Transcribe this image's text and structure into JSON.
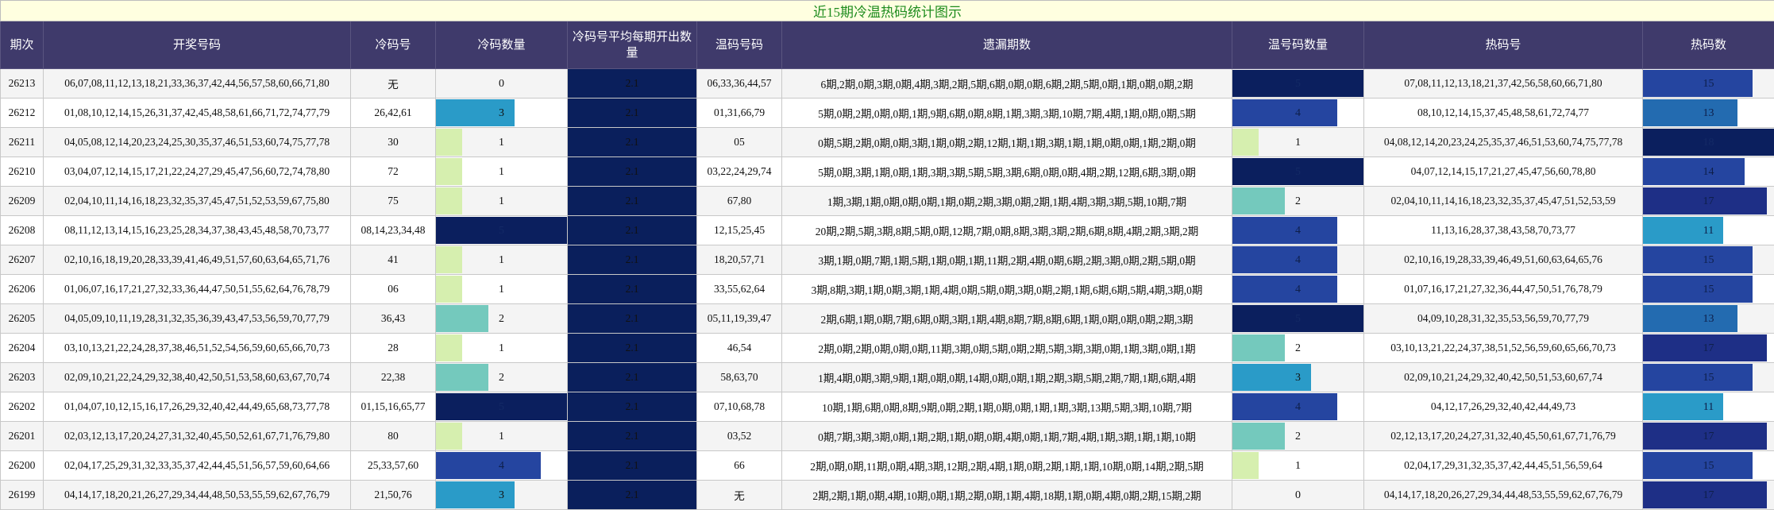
{
  "title": "近15期冷温热码统计图示",
  "headers": [
    "期次",
    "开奖号码",
    "冷码号",
    "冷码数量",
    "冷码号平均每期开出数量",
    "温码号码",
    "遗漏期数",
    "温号码数量",
    "热码号",
    "热码数"
  ],
  "max_cold": 5,
  "max_warm": 5,
  "max_hot": 18,
  "rows": [
    {
      "issue": "26213",
      "numbers": "06,07,08,11,12,13,18,21,33,36,37,42,44,56,57,58,60,66,71,80",
      "cold": "无",
      "cold_count": 0,
      "avg": "2.1",
      "warm": "06,33,36,44,57",
      "miss": "6期,2期,0期,3期,0期,4期,3期,2期,5期,6期,0期,0期,6期,2期,5期,0期,1期,0期,0期,2期",
      "warm_count": 5,
      "hot": "07,08,11,12,13,18,21,37,42,56,58,60,66,71,80",
      "hot_count": 15
    },
    {
      "issue": "26212",
      "numbers": "01,08,10,12,14,15,26,31,37,42,45,48,58,61,66,71,72,74,77,79",
      "cold": "26,42,61",
      "cold_count": 3,
      "avg": "2.1",
      "warm": "01,31,66,79",
      "miss": "5期,0期,2期,0期,0期,1期,9期,6期,0期,8期,1期,3期,3期,10期,7期,4期,1期,0期,0期,5期",
      "warm_count": 4,
      "hot": "08,10,12,14,15,37,45,48,58,61,72,74,77",
      "hot_count": 13
    },
    {
      "issue": "26211",
      "numbers": "04,05,08,12,14,20,23,24,25,30,35,37,46,51,53,60,74,75,77,78",
      "cold": "30",
      "cold_count": 1,
      "avg": "2.1",
      "warm": "05",
      "miss": "0期,5期,2期,0期,0期,3期,1期,0期,2期,12期,1期,1期,3期,1期,1期,0期,0期,1期,2期,0期",
      "warm_count": 1,
      "hot": "04,08,12,14,20,23,24,25,35,37,46,51,53,60,74,75,77,78",
      "hot_count": 18
    },
    {
      "issue": "26210",
      "numbers": "03,04,07,12,14,15,17,21,22,24,27,29,45,47,56,60,72,74,78,80",
      "cold": "72",
      "cold_count": 1,
      "avg": "2.1",
      "warm": "03,22,24,29,74",
      "miss": "5期,0期,3期,1期,0期,1期,3期,3期,5期,5期,3期,6期,0期,0期,4期,2期,12期,6期,3期,0期",
      "warm_count": 5,
      "hot": "04,07,12,14,15,17,21,27,45,47,56,60,78,80",
      "hot_count": 14
    },
    {
      "issue": "26209",
      "numbers": "02,04,10,11,14,16,18,23,32,35,37,45,47,51,52,53,59,67,75,80",
      "cold": "75",
      "cold_count": 1,
      "avg": "2.1",
      "warm": "67,80",
      "miss": "1期,3期,1期,0期,0期,0期,1期,0期,2期,3期,0期,2期,1期,4期,3期,3期,5期,10期,7期",
      "warm_count": 2,
      "hot": "02,04,10,11,14,16,18,23,32,35,37,45,47,51,52,53,59",
      "hot_count": 17
    },
    {
      "issue": "26208",
      "numbers": "08,11,12,13,14,15,16,23,25,28,34,37,38,43,45,48,58,70,73,77",
      "cold": "08,14,23,34,48",
      "cold_count": 5,
      "avg": "2.1",
      "warm": "12,15,25,45",
      "miss": "20期,2期,5期,3期,8期,5期,0期,12期,7期,0期,8期,3期,3期,2期,6期,8期,4期,2期,3期,2期",
      "warm_count": 4,
      "hot": "11,13,16,28,37,38,43,58,70,73,77",
      "hot_count": 11
    },
    {
      "issue": "26207",
      "numbers": "02,10,16,18,19,20,28,33,39,41,46,49,51,57,60,63,64,65,71,76",
      "cold": "41",
      "cold_count": 1,
      "avg": "2.1",
      "warm": "18,20,57,71",
      "miss": "3期,1期,0期,7期,1期,5期,1期,0期,1期,11期,2期,4期,0期,6期,2期,3期,0期,2期,5期,0期",
      "warm_count": 4,
      "hot": "02,10,16,19,28,33,39,46,49,51,60,63,64,65,76",
      "hot_count": 15
    },
    {
      "issue": "26206",
      "numbers": "01,06,07,16,17,21,27,32,33,36,44,47,50,51,55,62,64,76,78,79",
      "cold": "06",
      "cold_count": 1,
      "avg": "2.1",
      "warm": "33,55,62,64",
      "miss": "3期,8期,3期,1期,0期,3期,1期,4期,0期,5期,0期,3期,0期,2期,1期,6期,6期,5期,4期,3期,0期",
      "warm_count": 4,
      "hot": "01,07,16,17,21,27,32,36,44,47,50,51,76,78,79",
      "hot_count": 15
    },
    {
      "issue": "26205",
      "numbers": "04,05,09,10,11,19,28,31,32,35,36,39,43,47,53,56,59,70,77,79",
      "cold": "36,43",
      "cold_count": 2,
      "avg": "2.1",
      "warm": "05,11,19,39,47",
      "miss": "2期,6期,1期,0期,7期,6期,0期,3期,1期,4期,8期,7期,8期,6期,1期,0期,0期,0期,2期,3期",
      "warm_count": 5,
      "hot": "04,09,10,28,31,32,35,53,56,59,70,77,79",
      "hot_count": 13
    },
    {
      "issue": "26204",
      "numbers": "03,10,13,21,22,24,28,37,38,46,51,52,54,56,59,60,65,66,70,73",
      "cold": "28",
      "cold_count": 1,
      "avg": "2.1",
      "warm": "46,54",
      "miss": "2期,0期,2期,0期,0期,0期,11期,3期,0期,5期,0期,2期,5期,3期,3期,0期,1期,3期,0期,1期",
      "warm_count": 2,
      "hot": "03,10,13,21,22,24,37,38,51,52,56,59,60,65,66,70,73",
      "hot_count": 17
    },
    {
      "issue": "26203",
      "numbers": "02,09,10,21,22,24,29,32,38,40,42,50,51,53,58,60,63,67,70,74",
      "cold": "22,38",
      "cold_count": 2,
      "avg": "2.1",
      "warm": "58,63,70",
      "miss": "1期,4期,0期,3期,9期,1期,0期,0期,14期,0期,0期,1期,2期,3期,5期,2期,7期,1期,6期,4期",
      "warm_count": 3,
      "hot": "02,09,10,21,24,29,32,40,42,50,51,53,60,67,74",
      "hot_count": 15
    },
    {
      "issue": "26202",
      "numbers": "01,04,07,10,12,15,16,17,26,29,32,40,42,44,49,65,68,73,77,78",
      "cold": "01,15,16,65,77",
      "cold_count": 5,
      "avg": "2.1",
      "warm": "07,10,68,78",
      "miss": "10期,1期,6期,0期,8期,9期,0期,2期,1期,0期,0期,1期,1期,3期,13期,5期,3期,10期,7期",
      "warm_count": 4,
      "hot": "04,12,17,26,29,32,40,42,44,49,73",
      "hot_count": 11
    },
    {
      "issue": "26201",
      "numbers": "02,03,12,13,17,20,24,27,31,32,40,45,50,52,61,67,71,76,79,80",
      "cold": "80",
      "cold_count": 1,
      "avg": "2.1",
      "warm": "03,52",
      "miss": "0期,7期,3期,3期,0期,1期,2期,1期,0期,0期,4期,0期,1期,7期,4期,1期,3期,1期,1期,10期",
      "warm_count": 2,
      "hot": "02,12,13,17,20,24,27,31,32,40,45,50,61,67,71,76,79",
      "hot_count": 17
    },
    {
      "issue": "26200",
      "numbers": "02,04,17,25,29,31,32,33,35,37,42,44,45,51,56,57,59,60,64,66",
      "cold": "25,33,57,60",
      "cold_count": 4,
      "avg": "2.1",
      "warm": "66",
      "miss": "2期,0期,0期,11期,0期,4期,3期,12期,2期,4期,1期,0期,2期,1期,1期,10期,0期,14期,2期,5期",
      "warm_count": 1,
      "hot": "02,04,17,29,31,32,35,37,42,44,45,51,56,59,64",
      "hot_count": 15
    },
    {
      "issue": "26199",
      "numbers": "04,14,17,18,20,21,26,27,29,34,44,48,50,53,55,59,62,67,76,79",
      "cold": "21,50,76",
      "cold_count": 3,
      "avg": "2.1",
      "warm": "无",
      "miss": "2期,2期,1期,0期,4期,10期,0期,1期,2期,0期,1期,4期,18期,1期,0期,4期,0期,2期,15期,2期",
      "warm_count": 0,
      "hot": "04,14,17,18,20,26,27,29,34,44,48,53,55,59,62,67,76,79",
      "hot_count": 17
    }
  ]
}
